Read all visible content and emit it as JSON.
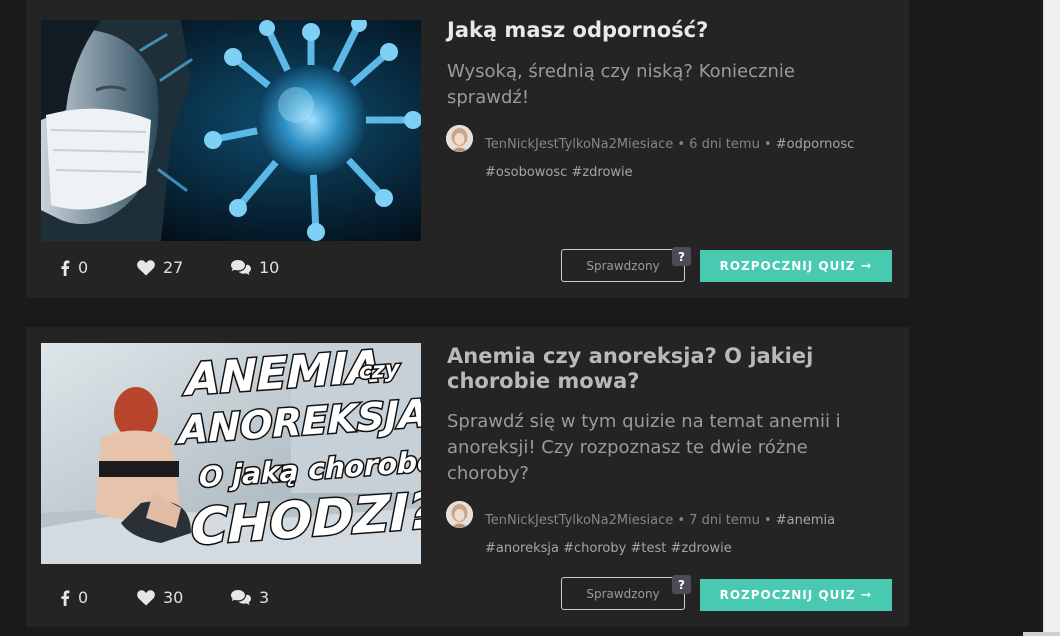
{
  "quizzes": [
    {
      "title": "Jaką masz odporność?",
      "description": "Wysoką, średnią czy niską? Koniecznie sprawdź!",
      "author": "TenNickJestTylkoNa2Miesiace",
      "time": "6 dni temu",
      "separator": "•",
      "tags": [
        "#odpornosc",
        "#osobowosc",
        "#zdrowie"
      ],
      "shares": "0",
      "likes": "27",
      "comments": "10",
      "verified_label": "Sprawdzony",
      "help_label": "?",
      "start_label": "ROZPOCZNIJ QUIZ",
      "start_arrow": "➞"
    },
    {
      "title": "Anemia czy anoreksja? O jakiej chorobie mowa?",
      "description": "Sprawdź się w tym quizie na temat anemii i anoreksji! Czy rozpoznasz te dwie różne choroby?",
      "author": "TenNickJestTylkoNa2Miesiace",
      "time": "7 dni temu",
      "separator": "•",
      "tags": [
        "#anemia",
        "#anoreksja",
        "#choroby",
        "#test",
        "#zdrowie"
      ],
      "shares": "0",
      "likes": "30",
      "comments": "3",
      "verified_label": "Sprawdzony",
      "help_label": "?",
      "start_label": "ROZPOCZNIJ QUIZ",
      "start_arrow": "➞",
      "thumbnail_text": {
        "line1": "ANEMIA",
        "line1_small": "czy",
        "line2": "ANOREKSJA?",
        "line3": "O jaką chorobę",
        "line4": "CHODZI?"
      }
    }
  ],
  "colors": {
    "background": "#1a1a1a",
    "card": "#242424",
    "accent": "#48c9b0",
    "help_badge": "#4c4c57"
  },
  "icons": {
    "share": "facebook-icon",
    "like": "heart-icon",
    "comment": "comments-icon"
  }
}
